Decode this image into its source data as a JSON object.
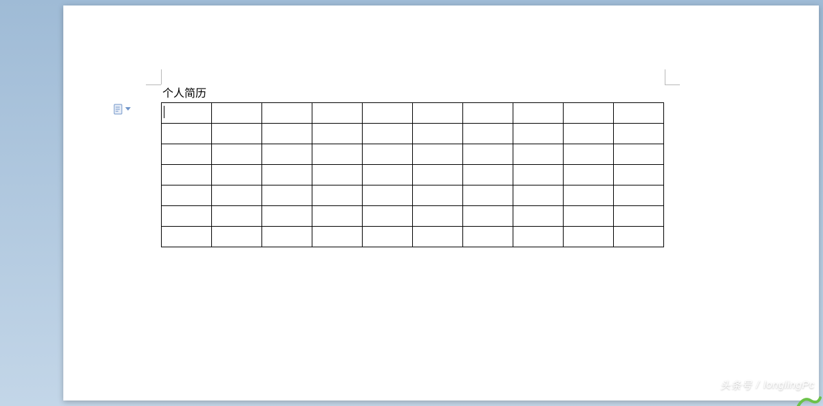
{
  "document": {
    "title": "个人简历",
    "cursor_cell": {
      "row": 0,
      "col": 0
    }
  },
  "table": {
    "rows": 7,
    "cols": 10,
    "cells": [
      [
        "",
        "",
        "",
        "",
        "",
        "",
        "",
        "",
        "",
        ""
      ],
      [
        "",
        "",
        "",
        "",
        "",
        "",
        "",
        "",
        "",
        ""
      ],
      [
        "",
        "",
        "",
        "",
        "",
        "",
        "",
        "",
        "",
        ""
      ],
      [
        "",
        "",
        "",
        "",
        "",
        "",
        "",
        "",
        "",
        ""
      ],
      [
        "",
        "",
        "",
        "",
        "",
        "",
        "",
        "",
        "",
        ""
      ],
      [
        "",
        "",
        "",
        "",
        "",
        "",
        "",
        "",
        "",
        ""
      ],
      [
        "",
        "",
        "",
        "",
        "",
        "",
        "",
        "",
        "",
        ""
      ]
    ]
  },
  "side_tool": {
    "name": "paste-options",
    "icon": "document-icon"
  },
  "watermark": {
    "prefix": "头条号",
    "separator": "/",
    "author": "longlingPc"
  }
}
